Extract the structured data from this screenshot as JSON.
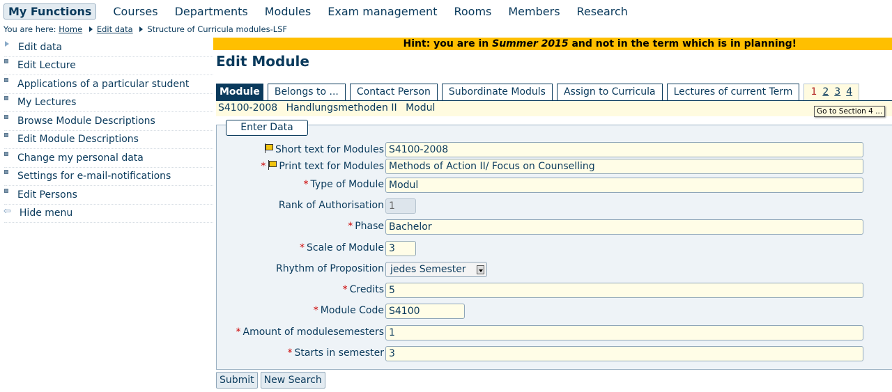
{
  "topnav": {
    "my_functions": "My Functions",
    "links": [
      "Courses",
      "Departments",
      "Modules",
      "Exam management",
      "Rooms",
      "Members",
      "Research"
    ]
  },
  "breadcrumb": {
    "prefix": "You are here:",
    "items": [
      "Home",
      "Edit data",
      "Structure of Curricula modules-LSF"
    ]
  },
  "sidebar": {
    "items": [
      {
        "label": "Edit data",
        "icon": "triangle-right-icon"
      },
      {
        "label": "Edit Lecture",
        "icon": "square-bullet-icon"
      },
      {
        "label": "Applications of a particular student",
        "icon": "square-bullet-icon"
      },
      {
        "label": "My Lectures",
        "icon": "square-bullet-icon"
      },
      {
        "label": "Browse Module Descriptions",
        "icon": "square-bullet-icon"
      },
      {
        "label": "Edit Module Descriptions",
        "icon": "square-bullet-icon"
      },
      {
        "label": "Change my personal data",
        "icon": "square-bullet-icon"
      },
      {
        "label": "Settings for e-mail-notifications",
        "icon": "square-bullet-icon"
      },
      {
        "label": "Edit Persons",
        "icon": "square-bullet-icon"
      },
      {
        "label": "Hide menu",
        "icon": "back-arrow-icon"
      }
    ]
  },
  "hint": {
    "before": "Hint: you are in ",
    "term": "Summer 2015",
    "after": " and not in the term which is in planning!",
    "color": "#ffbf00"
  },
  "page_title": "Edit Module",
  "tabs": {
    "items": [
      "Module",
      "Belongs to ...",
      "Contact Person",
      "Subordinate Moduls",
      "Assign to Curricula",
      "Lectures of current Term"
    ],
    "active_index": 0,
    "pages": [
      "1",
      "2",
      "3",
      "4"
    ]
  },
  "module_line": {
    "code": "S4100-2008",
    "name": "Handlungsmethoden II",
    "type": "Modul"
  },
  "tooltip": "Go to Section 4 ...",
  "form": {
    "legend": "Enter Data",
    "fields": {
      "short_text": {
        "label": "Short text for Modules",
        "value": "S4100-2008"
      },
      "print_text": {
        "label": "Print text for Modules",
        "value": "Methods of Action II/ Focus on Counselling"
      },
      "type": {
        "label": "Type of Module",
        "value": "Modul"
      },
      "rank": {
        "label": "Rank of Authorisation",
        "value": "1"
      },
      "phase": {
        "label": "Phase",
        "value": "Bachelor"
      },
      "scale": {
        "label": "Scale of Module",
        "value": "3"
      },
      "rhythm": {
        "label": "Rhythm of Proposition",
        "value": "jedes Semester"
      },
      "credits": {
        "label": "Credits",
        "value": "5"
      },
      "module_code": {
        "label": "Module Code",
        "value": "S4100"
      },
      "amount": {
        "label": "Amount of modulesemesters",
        "value": "1"
      },
      "starts": {
        "label": "Starts in semester",
        "value": "3"
      }
    },
    "required_mark": "*"
  },
  "buttons": {
    "submit": "Submit",
    "new_search": "New Search"
  }
}
